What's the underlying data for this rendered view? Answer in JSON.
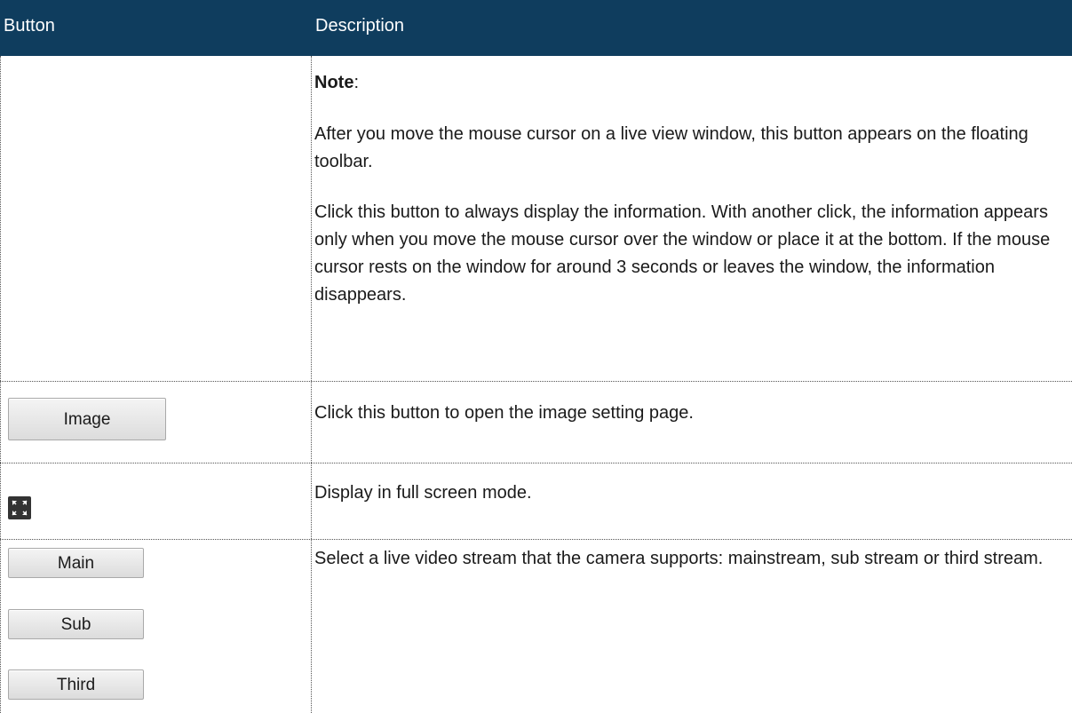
{
  "table": {
    "header": {
      "button_col": "Button",
      "description_col": "Description"
    },
    "rows": [
      {
        "note_label": "Note",
        "note_colon": ":",
        "paragraph1": "After you move the mouse cursor on a live view window, this button appears on the floating toolbar.",
        "paragraph2": "Click this button to always display the information. With another click, the information appears only when you move the mouse cursor over the window or place it at the bottom. If the mouse cursor rests on the window for around 3 seconds or leaves the window, the information disappears."
      },
      {
        "button_label": "Image",
        "description": "Click this button to open the image setting page."
      },
      {
        "icon": "fullscreen-icon",
        "description": "Display in full screen mode."
      },
      {
        "buttons": [
          "Main",
          "Sub",
          "Third"
        ],
        "description": "Select a live video stream that the camera supports: mainstream, sub stream or third stream."
      }
    ]
  },
  "colors": {
    "header_bg": "#0f3d5e",
    "header_text": "#ffffff"
  }
}
